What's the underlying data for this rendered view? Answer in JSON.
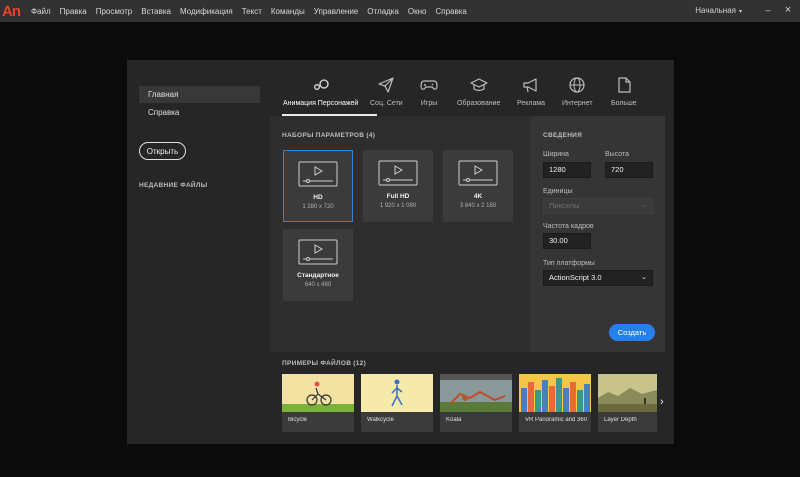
{
  "app": {
    "logo": "An"
  },
  "menu": [
    "Файл",
    "Правка",
    "Просмотр",
    "Вставка",
    "Модификация",
    "Текст",
    "Команды",
    "Управление",
    "Отладка",
    "Окно",
    "Справка"
  ],
  "workspace": {
    "label": "Начальная",
    "caret": "▾"
  },
  "window_controls": {
    "minimize": "–",
    "close": "×"
  },
  "sidebar": {
    "items": [
      {
        "label": "Главная",
        "active": true
      },
      {
        "label": "Справка",
        "active": false
      }
    ],
    "open_button": "Открыть",
    "recent_label": "НЕДАВНИЕ ФАЙЛЫ"
  },
  "tabs": [
    {
      "label": "Анимация Персонажей",
      "icon": "character-animation-icon",
      "active": true
    },
    {
      "label": "Соц. Сети",
      "icon": "paper-plane-icon",
      "active": false
    },
    {
      "label": "Игры",
      "icon": "gamepad-icon",
      "active": false
    },
    {
      "label": "Образование",
      "icon": "graduation-cap-icon",
      "active": false
    },
    {
      "label": "Реклама",
      "icon": "megaphone-icon",
      "active": false
    },
    {
      "label": "Интернет",
      "icon": "globe-icon",
      "active": false
    },
    {
      "label": "Больше",
      "icon": "document-icon",
      "active": false
    }
  ],
  "presets": {
    "title": "НАБОРЫ ПАРАМЕТРОВ (4)",
    "items": [
      {
        "name": "HD",
        "size": "1 280 x 720",
        "selected": true
      },
      {
        "name": "Full HD",
        "size": "1 920 x 1 080",
        "selected": false
      },
      {
        "name": "4K",
        "size": "3 840 x 2 160",
        "selected": false
      },
      {
        "name": "Стандартное",
        "size": "640 x 480",
        "selected": false
      }
    ]
  },
  "details": {
    "title": "СВЕДЕНИЯ",
    "width_label": "Ширина",
    "width_value": "1280",
    "height_label": "Высота",
    "height_value": "720",
    "units_label": "Единицы",
    "units_value": "Пикселы",
    "fps_label": "Частота кадров",
    "fps_value": "30.00",
    "platform_label": "Тип платформы",
    "platform_value": "ActionScript 3.0",
    "create_button": "Создать"
  },
  "samples": {
    "title": "ПРИМЕРЫ ФАЙЛОВ (12)",
    "items": [
      "Bicycle",
      "Walkcycle",
      "Koala",
      "VR Panoramic and 360 ...",
      "Layer Depth"
    ],
    "next_icon": "›"
  },
  "colors": {
    "accent": "#2680eb",
    "selected_border": "#2e86de",
    "logo": "#e8442c"
  }
}
